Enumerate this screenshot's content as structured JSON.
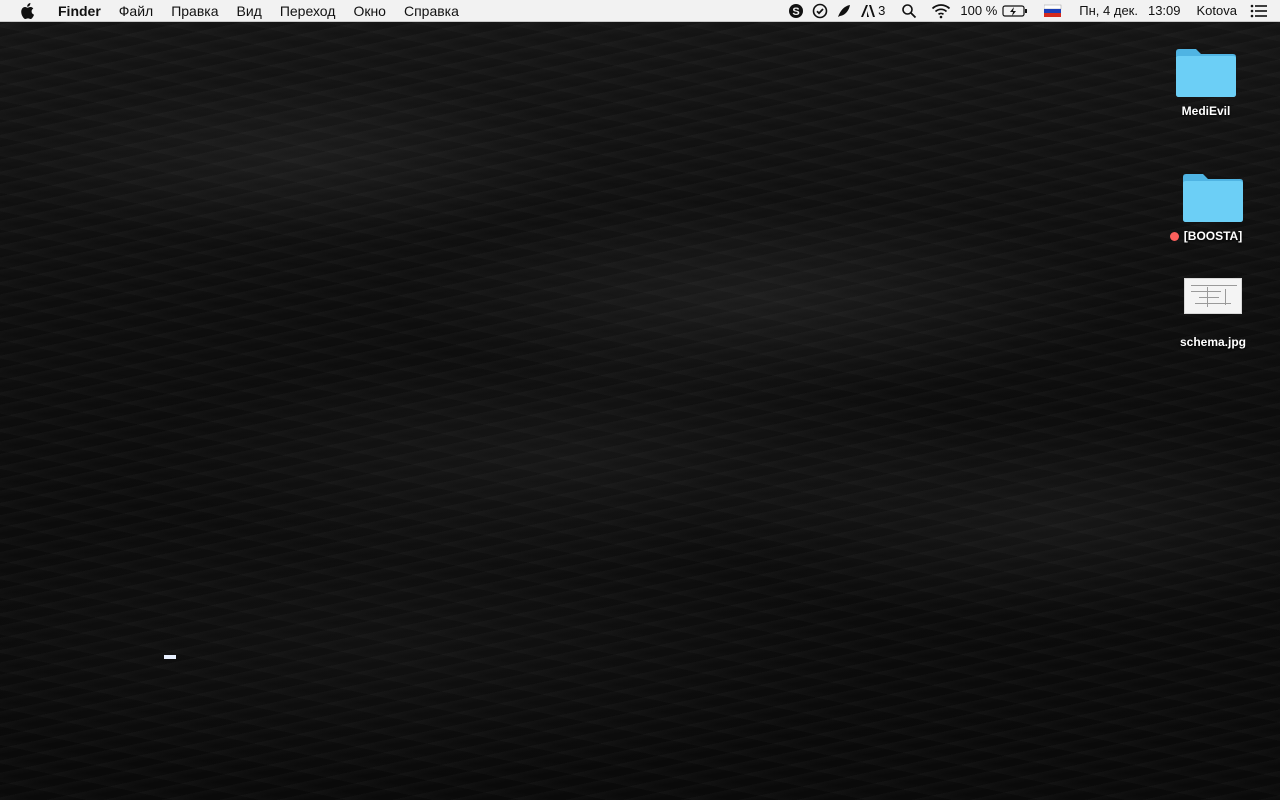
{
  "menubar": {
    "app_name": "Finder",
    "menus": [
      "Файл",
      "Правка",
      "Вид",
      "Переход",
      "Окно",
      "Справка"
    ],
    "status": {
      "adobe_count": "3",
      "battery": "100 %",
      "date": "Пн, 4 дек.",
      "time": "13:09",
      "user": "Kotova"
    },
    "status_icons": [
      "skype-icon",
      "check-circle-icon",
      "feather-icon",
      "adobe-icon",
      "spotlight-icon",
      "wifi-icon",
      "battery-icon",
      "flag-ru-icon",
      "notification-list-icon"
    ]
  },
  "desktop": {
    "items": [
      {
        "label": "MediEvil",
        "kind": "folder",
        "tag": null
      },
      {
        "label": "[BOOSTA]",
        "kind": "folder",
        "tag": "red"
      },
      {
        "label": "schema.jpg",
        "kind": "image",
        "tag": null
      }
    ]
  },
  "colors": {
    "menubar_bg": "#f2f2f2",
    "folder": "#6ccff6",
    "tag_red": "#fc605c"
  }
}
